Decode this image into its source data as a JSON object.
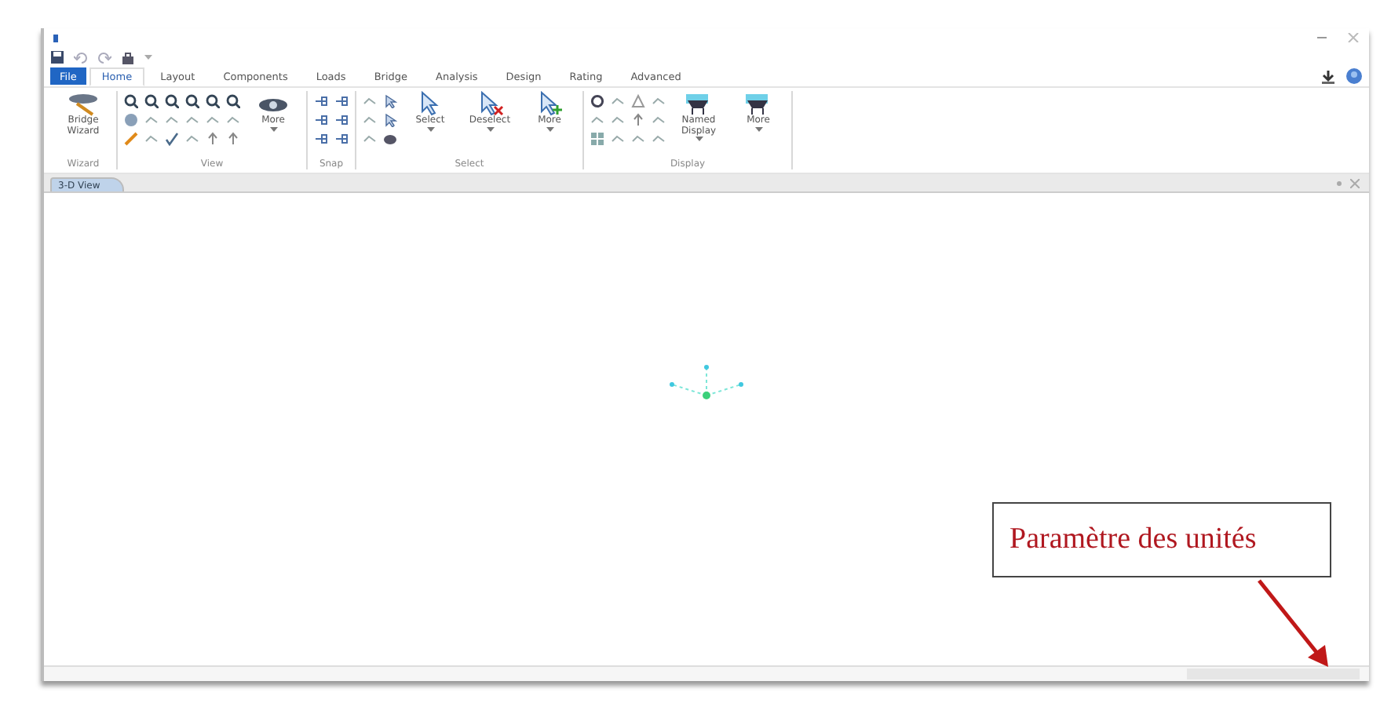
{
  "menu": {
    "file": "File",
    "tabs": [
      {
        "label": "Home",
        "selected": true
      },
      {
        "label": "Layout",
        "selected": false
      },
      {
        "label": "Components",
        "selected": false
      },
      {
        "label": "Loads",
        "selected": false
      },
      {
        "label": "Bridge",
        "selected": false
      },
      {
        "label": "Analysis",
        "selected": false
      },
      {
        "label": "Design",
        "selected": false
      },
      {
        "label": "Rating",
        "selected": false
      },
      {
        "label": "Advanced",
        "selected": false
      }
    ]
  },
  "ribbon": {
    "groups": [
      {
        "name": "Wizard",
        "items": [
          {
            "kind": "large",
            "label": "Bridge Wizard"
          }
        ]
      },
      {
        "name": "View",
        "items": [
          {
            "kind": "grid"
          },
          {
            "kind": "large",
            "label": "More",
            "dropdown": true
          }
        ]
      },
      {
        "name": "Snap",
        "items": [
          {
            "kind": "grid"
          }
        ]
      },
      {
        "name": "Select",
        "items": [
          {
            "kind": "grid"
          },
          {
            "kind": "large",
            "label": "Select",
            "dropdown": true
          },
          {
            "kind": "large",
            "label": "Deselect",
            "dropdown": true
          },
          {
            "kind": "large",
            "label": "More",
            "dropdown": true
          }
        ]
      },
      {
        "name": "Display",
        "items": [
          {
            "kind": "grid"
          },
          {
            "kind": "large",
            "label": "Named Display",
            "dropdown": true
          },
          {
            "kind": "large",
            "label": "More",
            "dropdown": true
          }
        ]
      }
    ]
  },
  "view_tabs": [
    {
      "label": "3-D View",
      "selected": true
    }
  ],
  "annotation": {
    "text": "Paramètre des unités"
  }
}
